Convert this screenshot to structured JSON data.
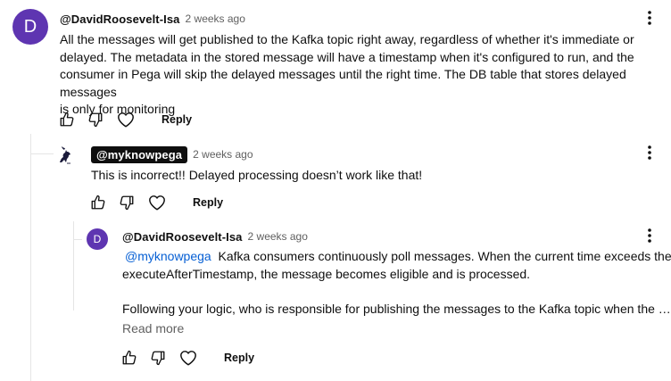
{
  "comments": [
    {
      "avatar_letter": "D",
      "author": "@DavidRoosevelt-Isa",
      "time": "2 weeks ago",
      "text_lines": [
        "All the messages will get published to the Kafka topic right away, regardless of whether it's immediate or",
        "delayed. The metadata in the stored message will have a timestamp when it's configured to run, and the",
        "consumer in Pega will skip the delayed messages until the right time. The DB table that stores delayed messages",
        "is only for monitoring"
      ],
      "reply_label": "Reply"
    },
    {
      "author": "@myknowpega",
      "time": "2 weeks ago",
      "text": "This is incorrect!! Delayed processing doesn’t work like that!",
      "reply_label": "Reply"
    },
    {
      "avatar_letter": "D",
      "author": "@DavidRoosevelt-Isa",
      "time": "2 weeks ago",
      "mention": "@myknowpega",
      "line1_rest": "Kafka consumers continuously poll messages. When the current time exceeds the",
      "line2": "executeAfterTimestamp, the message becomes eligible and is processed.",
      "line4": "Following your logic, who is responsible for publishing the messages to the Kafka topic when the …",
      "read_more": "Read more",
      "reply_label": "Reply"
    }
  ],
  "icons": [
    "like-icon",
    "dislike-icon",
    "heart-icon",
    "more-vert-icon"
  ],
  "colors": {
    "avatar": "#5e35b1",
    "mention": "#065fd4",
    "secondary": "#606060"
  }
}
